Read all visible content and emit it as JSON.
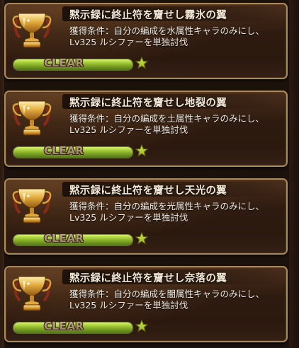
{
  "colors": {
    "card_border": "#a98a5a",
    "progress_green": "#9fd22e",
    "star_green": "#c7e03a",
    "title_text": "#f3e8d6"
  },
  "achievements": [
    {
      "title": "黙示録に終止符を齎せし霧氷の翼",
      "description": "獲得条件：自分の編成を水属性キャラのみにし、\nLv325 ルシファーを単独討伐",
      "status": "CLEAR",
      "progress": 1.0,
      "icon": "trophy-icon"
    },
    {
      "title": "黙示録に終止符を齎せし地裂の翼",
      "description": "獲得条件：自分の編成を土属性キャラのみにし、\nLv325 ルシファーを単独討伐",
      "status": "CLEAR",
      "progress": 1.0,
      "icon": "trophy-icon"
    },
    {
      "title": "黙示録に終止符を齎せし天光の翼",
      "description": "獲得条件：自分の編成を光属性キャラのみにし、\nLv325 ルシファーを単独討伐",
      "status": "CLEAR",
      "progress": 1.0,
      "icon": "trophy-icon"
    },
    {
      "title": "黙示録に終止符を齎せし奈落の翼",
      "description": "獲得条件：自分の編成を闇属性キャラのみにし、\nLv325 ルシファーを単独討伐",
      "status": "CLEAR",
      "progress": 1.0,
      "icon": "trophy-icon"
    }
  ]
}
